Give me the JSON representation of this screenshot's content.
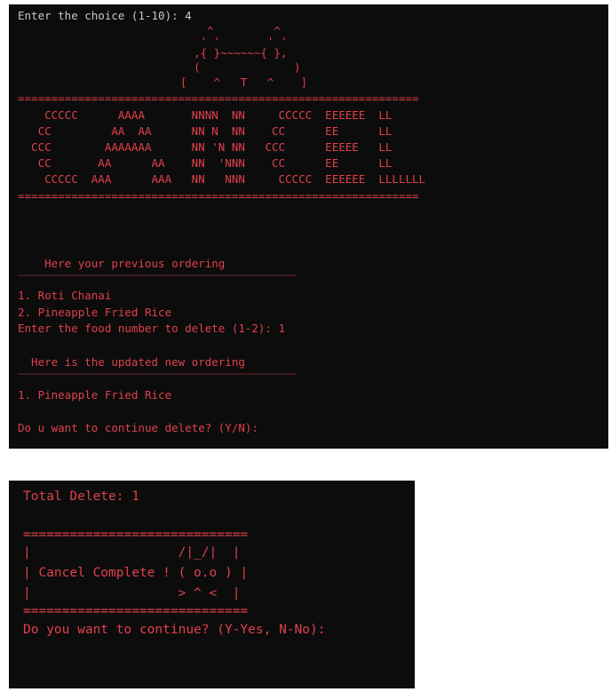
{
  "terminal1": {
    "prompt_choice": "Enter the choice (1-10): 4",
    "cat_art": [
      "      ^         ^",
      "     ' '       ' '",
      "    ,{ }~~~~~~{ },",
      "    (              )",
      "  [    ^   T   ^    ]"
    ],
    "separator": "============================================================",
    "banner": [
      "    CCCCC      AAAA       NNNN  NN     CCCCC  EEEEEE  LL",
      "   CC         AA  AA      NN N  NN    CC      EE      LL",
      "  CCC        AAAAAAA      NN 'N NN   CCC      EEEEE   LL",
      "   CC       AA      AA    NN  'NNN    CC      EE      LL",
      "    CCCCC  AAA      AAA   NN   NNN     CCCCC  EEEEEE  LLLLLLL"
    ],
    "previous_heading": "    Here your previous ordering",
    "tilde_line": "~~~~~~~~~~~~~~~~~~~~~~~~~~~~~~~~~~~~~~~~~~~~~~~~~~~~~~~~~~~~~~~~~~~~~~~~~~~~~~~~~~~~~~~",
    "previous_items": [
      "1. Roti Chanai",
      "2. Pineapple Fried Rice"
    ],
    "delete_prompt": "Enter the food number to delete (1-2): 1",
    "updated_heading": "  Here is the updated new ordering",
    "updated_items": [
      "1. Pineapple Fried Rice"
    ],
    "continue_delete": "Do u want to continue delete? (Y/N):"
  },
  "terminal2": {
    "total_delete": "Total Delete: 1",
    "separator": "=============================",
    "box_lines": [
      "|                   /|_/|  |",
      "| Cancel Complete ! ( o.o ) |",
      "|                   > ^ <  |"
    ],
    "continue_prompt": "Do you want to continue? (Y-Yes, N-No):"
  }
}
